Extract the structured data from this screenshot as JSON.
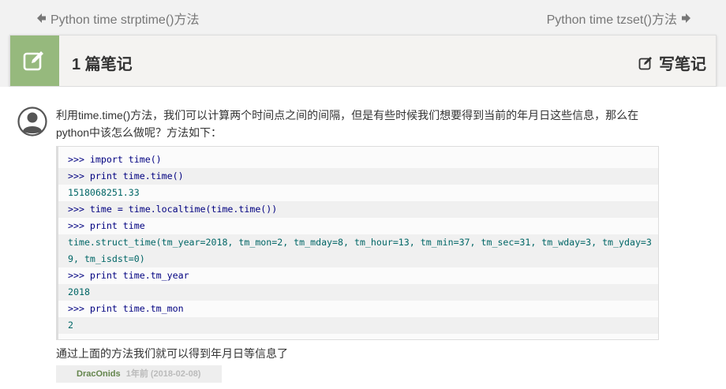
{
  "nav": {
    "prev_label": "Python time strptime()方法",
    "next_label": "Python time tzset()方法"
  },
  "notes_header": {
    "count_label": "1 篇笔记",
    "write_label": "写笔记"
  },
  "comment": {
    "text": "利用time.time()方法，我们可以计算两个时间点之间的间隔，但是有些时候我们想要得到当前的年月日这些信息，那么在python中该怎么做呢？方法如下：",
    "code_lines": [
      {
        "prompt": ">>> ",
        "code": "import time()",
        "kind": "input"
      },
      {
        "prompt": ">>> ",
        "code": "print time.time()",
        "kind": "input"
      },
      {
        "prompt": "",
        "code": "1518068251.33",
        "kind": "output"
      },
      {
        "prompt": ">>> ",
        "code": "time = time.localtime(time.time())",
        "kind": "input"
      },
      {
        "prompt": ">>> ",
        "code": "print time",
        "kind": "input"
      },
      {
        "prompt": "",
        "code": "time.struct_time(tm_year=2018, tm_mon=2, tm_mday=8, tm_hour=13, tm_min=37, tm_sec=31, tm_wday=3, tm_yday=39, tm_isdst=0)",
        "kind": "output"
      },
      {
        "prompt": ">>> ",
        "code": "print time.tm_year",
        "kind": "input"
      },
      {
        "prompt": "",
        "code": "2018",
        "kind": "output"
      },
      {
        "prompt": ">>> ",
        "code": "print time.tm_mon",
        "kind": "input"
      },
      {
        "prompt": "",
        "code": "2",
        "kind": "output"
      }
    ],
    "after_text": "通过上面的方法我们就可以得到年月日等信息了",
    "author": "DracOnids",
    "time": "1年前 (2018-02-08)"
  },
  "colors": {
    "accent_green": "#96b97d",
    "author_green": "#64854c"
  }
}
